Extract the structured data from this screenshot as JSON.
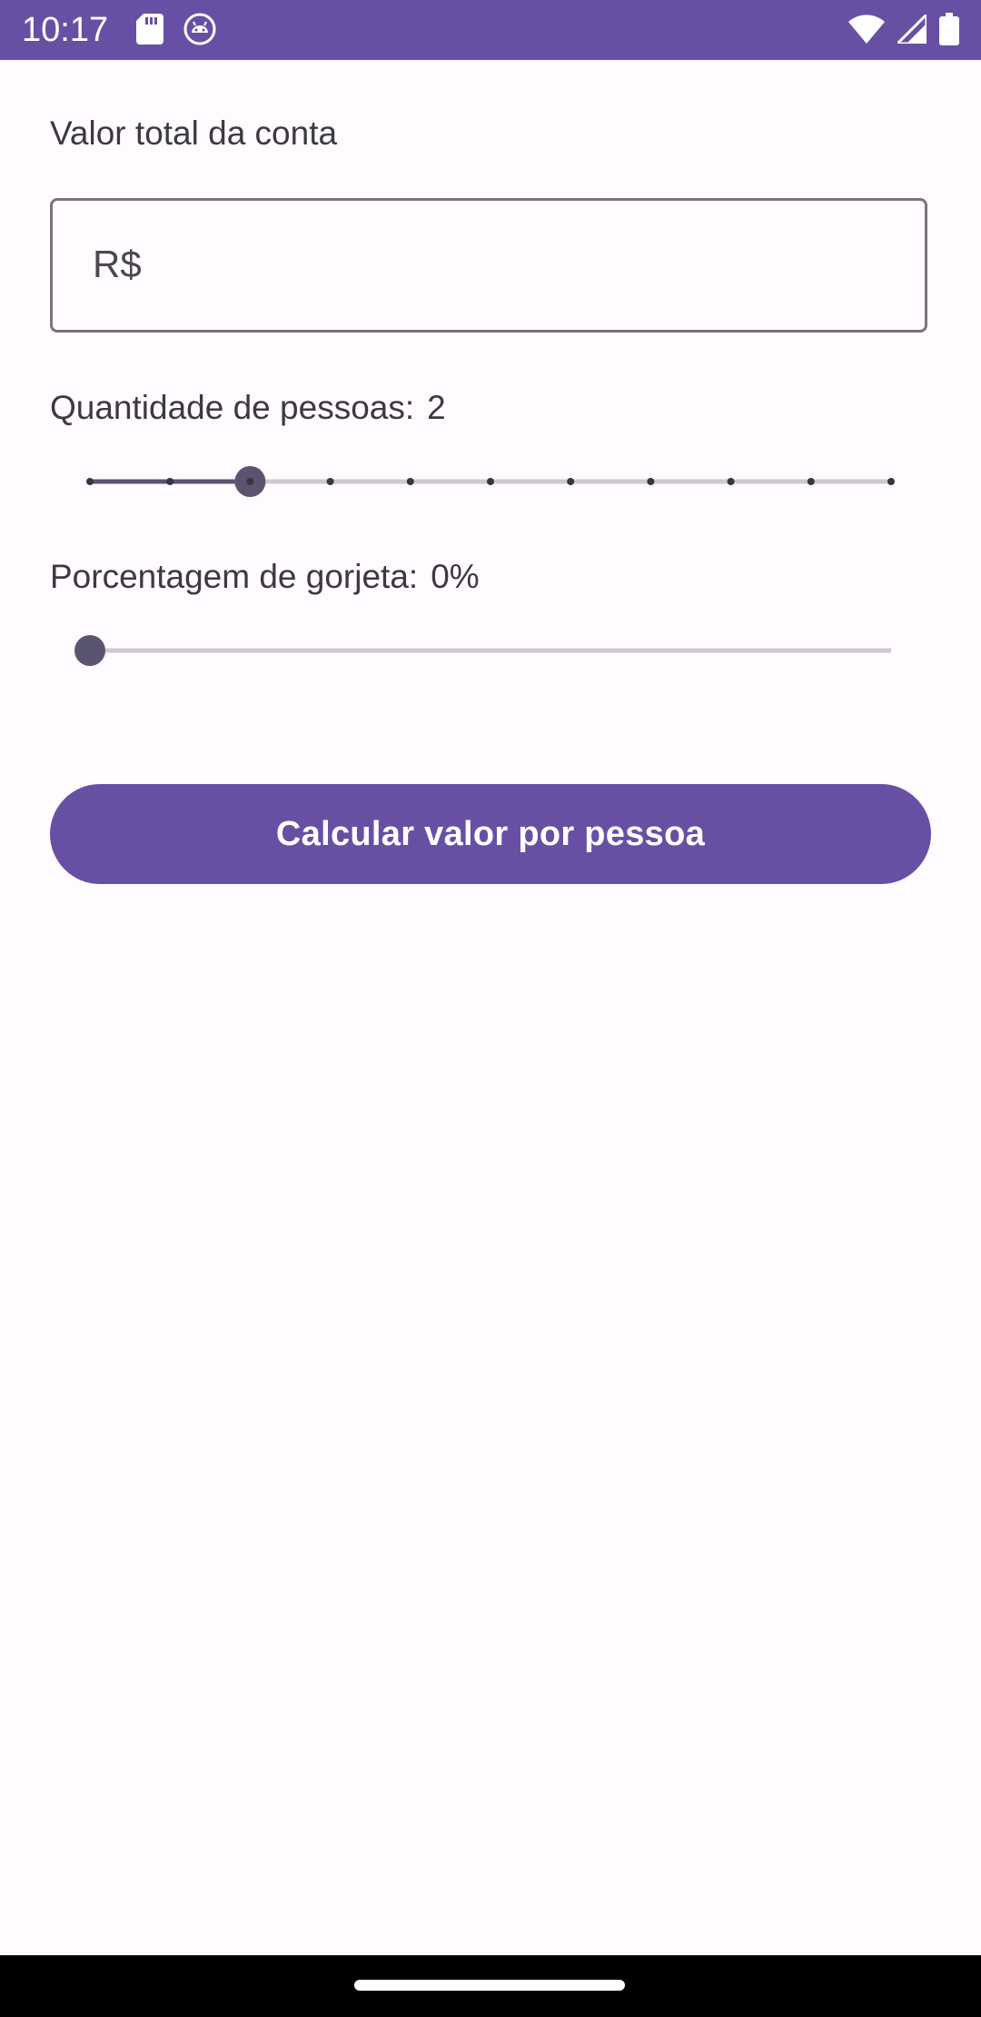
{
  "status_bar": {
    "time": "10:17",
    "icons_left": [
      "sd-card-icon",
      "android-robot-icon"
    ],
    "icons_right": [
      "wifi-icon",
      "signal-icon",
      "battery-icon"
    ]
  },
  "bill": {
    "label": "Valor total da conta",
    "prefix": "R$",
    "value": ""
  },
  "people": {
    "label": "Quantidade de pessoas:",
    "value_text": "2",
    "value": 2,
    "min": 0,
    "max": 10,
    "steps": 11
  },
  "tip": {
    "label": "Porcentagem de gorjeta:",
    "value_text": "0%",
    "value": 0
  },
  "calculate_button": {
    "label": "Calcular valor por pessoa"
  },
  "colors": {
    "primary": "#6750a4",
    "slider_active": "#5b5470",
    "slider_inactive": "#cdc9cf",
    "background": "#fffbfe"
  }
}
